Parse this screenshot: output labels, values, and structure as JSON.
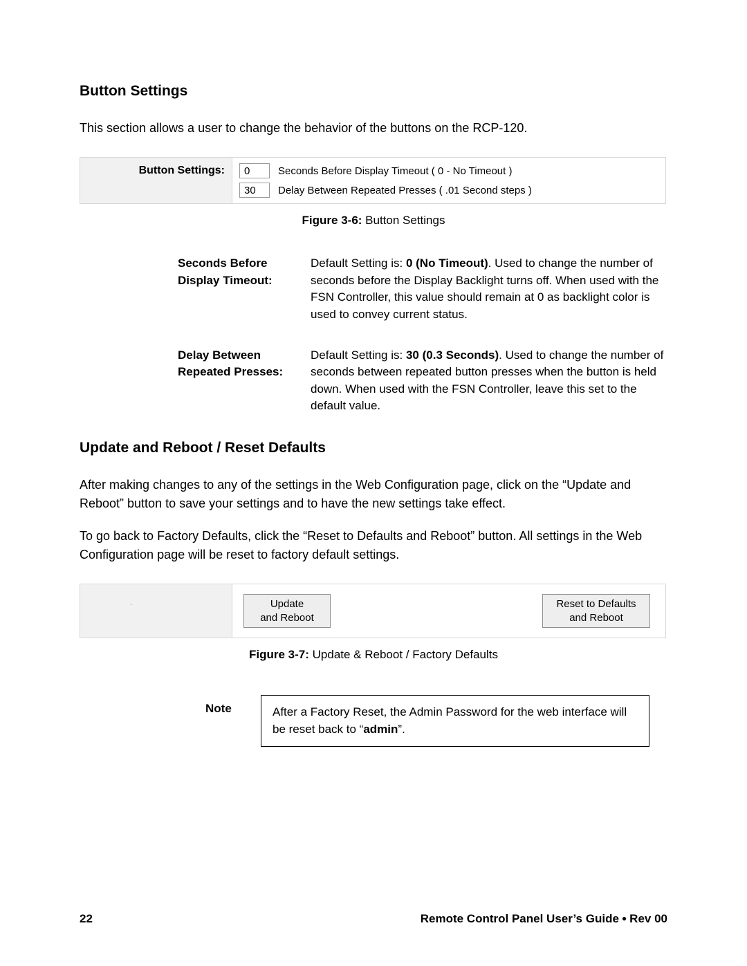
{
  "section1": {
    "heading": "Button Settings",
    "intro": "This section allows a user to change the behavior of the buttons on the RCP-120.",
    "panel_label": "Button Settings:",
    "rows": [
      {
        "value": "0",
        "text": "Seconds Before Display Timeout ( 0 - No Timeout )"
      },
      {
        "value": "30",
        "text": "Delay Between Repeated Presses ( .01 Second steps )"
      }
    ],
    "caption_bold": "Figure 3-6:",
    "caption_rest": " Button Settings"
  },
  "defs": [
    {
      "term": "Seconds Before Display Timeout:",
      "pre": "Default Setting is: ",
      "bold": "0 (No Timeout)",
      "post": ". Used to change the number of seconds before the Display Backlight turns off. When used with the FSN Controller, this value should remain at 0 as backlight color is used to convey current status."
    },
    {
      "term": "Delay Between Repeated Presses:",
      "pre": "Default Setting is: ",
      "bold": "30 (0.3 Seconds)",
      "post": ". Used to change the number of seconds between repeated button presses when the button is held down. When used with the FSN Controller, leave this set to the default value."
    }
  ],
  "section2": {
    "heading": "Update and Reboot / Reset Defaults",
    "p1": "After making changes to any of the settings in the Web Configuration page, click on the “Update and Reboot” button to save your settings and to have the new settings take effect.",
    "p2": "To go back to Factory Defaults, click the “Reset to Defaults and Reboot” button. All settings in the Web Configuration page will be reset to factory default settings.",
    "btn_update": "Update\nand Reboot",
    "btn_reset": "Reset to Defaults\nand Reboot",
    "caption_bold": "Figure 3-7:",
    "caption_rest": " Update & Reboot / Factory Defaults"
  },
  "note": {
    "label": "Note",
    "pre": "After a Factory Reset, the Admin Password for the web interface will be reset back to “",
    "bold": "admin",
    "post": "”."
  },
  "footer": {
    "page": "22",
    "guide_bold": "Remote Control Panel User’s Guide",
    "guide_rev": "Rev 00"
  }
}
